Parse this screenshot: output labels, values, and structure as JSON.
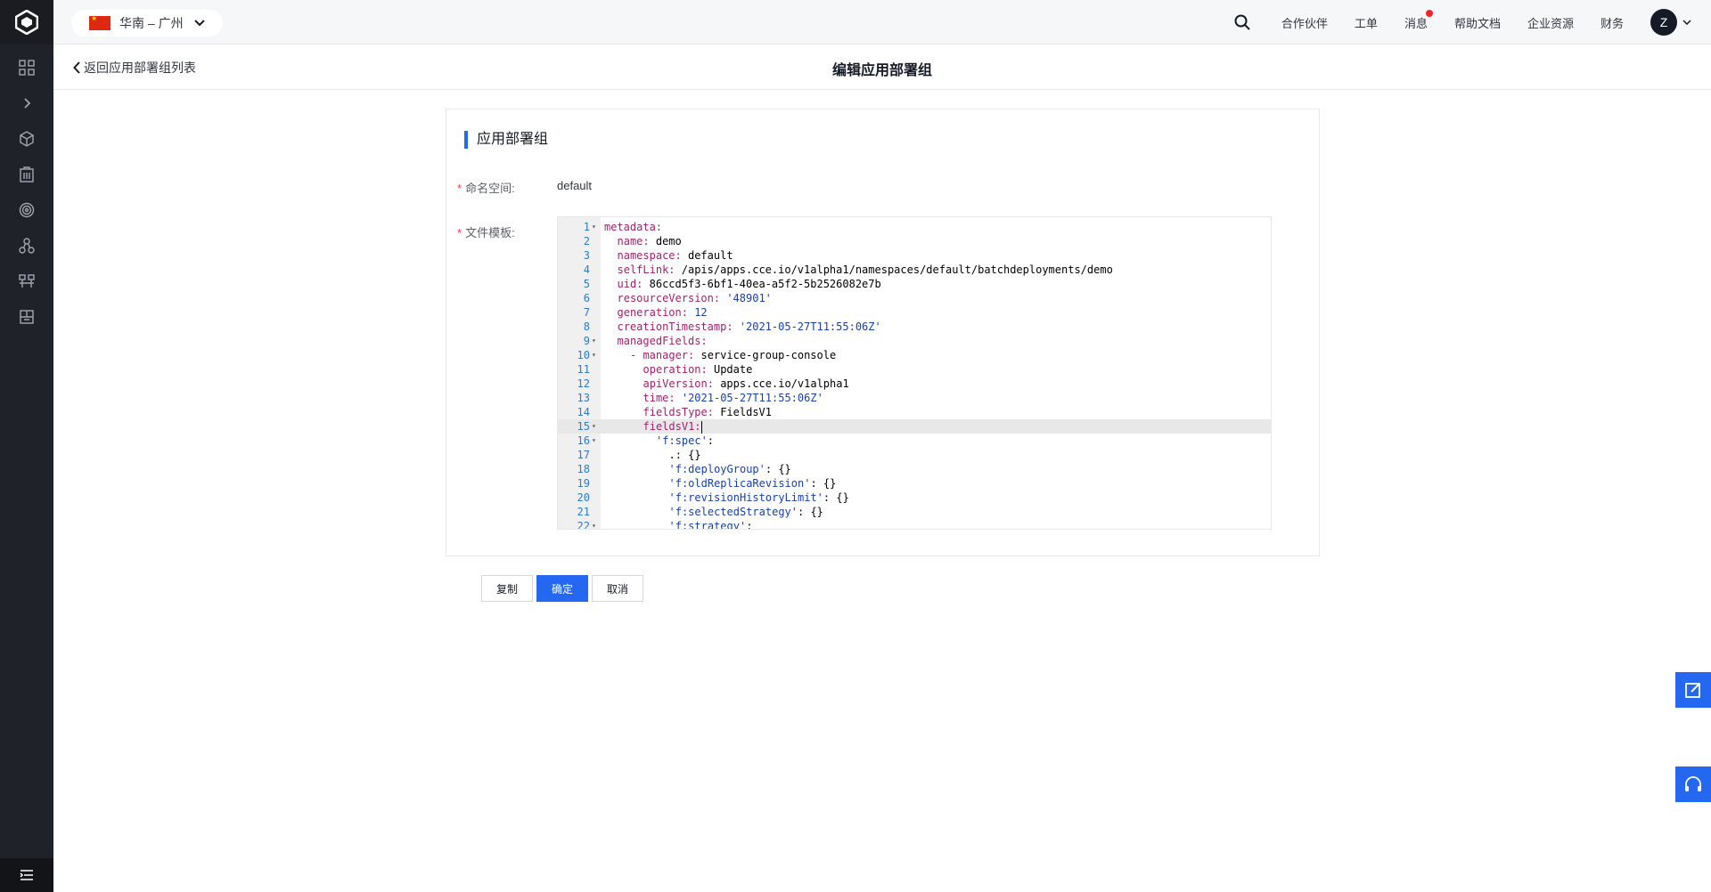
{
  "header": {
    "region": "华南 – 广州",
    "nav": [
      "合作伙伴",
      "工单",
      "消息",
      "帮助文档",
      "企业资源",
      "财务"
    ],
    "avatar_initial": "Z"
  },
  "subheader": {
    "back_label": "返回应用部署组列表",
    "title": "编辑应用部署组"
  },
  "panel": {
    "title": "应用部署组",
    "namespace_label": "命名空间:",
    "namespace_value": "default",
    "template_label": "文件模板:"
  },
  "editor": {
    "active_line": 15,
    "lines": [
      {
        "n": "1",
        "fold": true,
        "indent": 0,
        "key": "metadata:",
        "val": ""
      },
      {
        "n": "2",
        "fold": false,
        "indent": 2,
        "key": "name:",
        "val": " demo"
      },
      {
        "n": "3",
        "fold": false,
        "indent": 2,
        "key": "namespace:",
        "val": " default"
      },
      {
        "n": "4",
        "fold": false,
        "indent": 2,
        "key": "selfLink:",
        "val": " /apis/apps.cce.io/v1alpha1/namespaces/default/batchdeployments/demo"
      },
      {
        "n": "5",
        "fold": false,
        "indent": 2,
        "key": "uid:",
        "val": " 86ccd5f3-6bf1-40ea-a5f2-5b2526082e7b"
      },
      {
        "n": "6",
        "fold": false,
        "indent": 2,
        "key": "resourceVersion:",
        "str": " '48901'"
      },
      {
        "n": "7",
        "fold": false,
        "indent": 2,
        "key": "generation:",
        "str": " 12"
      },
      {
        "n": "8",
        "fold": false,
        "indent": 2,
        "key": "creationTimestamp:",
        "str": " '2021-05-27T11:55:06Z'"
      },
      {
        "n": "9",
        "fold": true,
        "indent": 2,
        "key": "managedFields:",
        "val": ""
      },
      {
        "n": "10",
        "fold": true,
        "indent": 4,
        "key": "- manager:",
        "val": " service-group-console"
      },
      {
        "n": "11",
        "fold": false,
        "indent": 6,
        "key": "operation:",
        "val": " Update"
      },
      {
        "n": "12",
        "fold": false,
        "indent": 6,
        "key": "apiVersion:",
        "val": " apps.cce.io/v1alpha1"
      },
      {
        "n": "13",
        "fold": false,
        "indent": 6,
        "key": "time:",
        "str": " '2021-05-27T11:55:06Z'"
      },
      {
        "n": "14",
        "fold": false,
        "indent": 6,
        "key": "fieldsType:",
        "val": " FieldsV1"
      },
      {
        "n": "15",
        "fold": true,
        "indent": 6,
        "key": "fieldsV1:",
        "val": ""
      },
      {
        "n": "16",
        "fold": true,
        "indent": 8,
        "str0": "'f:spec'",
        "val": ":"
      },
      {
        "n": "17",
        "fold": false,
        "indent": 10,
        "key": "",
        "val": ".: {}"
      },
      {
        "n": "18",
        "fold": false,
        "indent": 10,
        "str0": "'f:deployGroup'",
        "val": ": {}"
      },
      {
        "n": "19",
        "fold": false,
        "indent": 10,
        "str0": "'f:oldReplicaRevision'",
        "val": ": {}"
      },
      {
        "n": "20",
        "fold": false,
        "indent": 10,
        "str0": "'f:revisionHistoryLimit'",
        "val": ": {}"
      },
      {
        "n": "21",
        "fold": false,
        "indent": 10,
        "str0": "'f:selectedStrategy'",
        "val": ": {}"
      },
      {
        "n": "22",
        "fold": true,
        "indent": 10,
        "str0": "'f:strategy'",
        "val": ":"
      }
    ]
  },
  "buttons": {
    "copy": "复制",
    "confirm": "确定",
    "cancel": "取消"
  },
  "colors": {
    "primary": "#2468f2",
    "sidebar": "#1f2229",
    "yaml_key": "#a0226c",
    "yaml_string": "#1a3fa6"
  }
}
